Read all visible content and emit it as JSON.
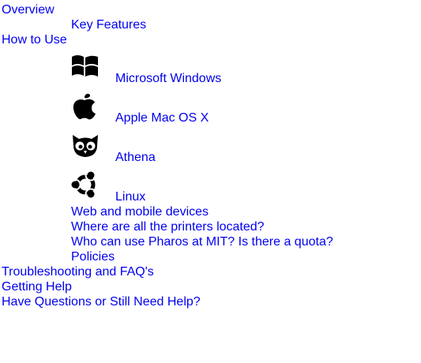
{
  "toc": {
    "overview": "Overview",
    "key_features": "Key Features",
    "how_to_use": "How to Use",
    "os_items": [
      {
        "label": "Microsoft Windows",
        "icon": "windows-logo-icon"
      },
      {
        "label": "Apple Mac OS X",
        "icon": "apple-logo-icon"
      },
      {
        "label": "Athena",
        "icon": "owl-logo-icon"
      },
      {
        "label": "Linux",
        "icon": "ubuntu-logo-icon"
      }
    ],
    "web_mobile": "Web and mobile devices",
    "printers_located": "Where are all the printers located?",
    "who_can_use": "Who can use Pharos at MIT? Is there a quota?",
    "policies": "Policies",
    "troubleshooting": "Troubleshooting and FAQ's",
    "getting_help": "Getting Help",
    "have_questions": "Have Questions or Still Need Help?"
  },
  "colors": {
    "link": "#0000ee",
    "icon": "#000000",
    "background": "#ffffff"
  }
}
